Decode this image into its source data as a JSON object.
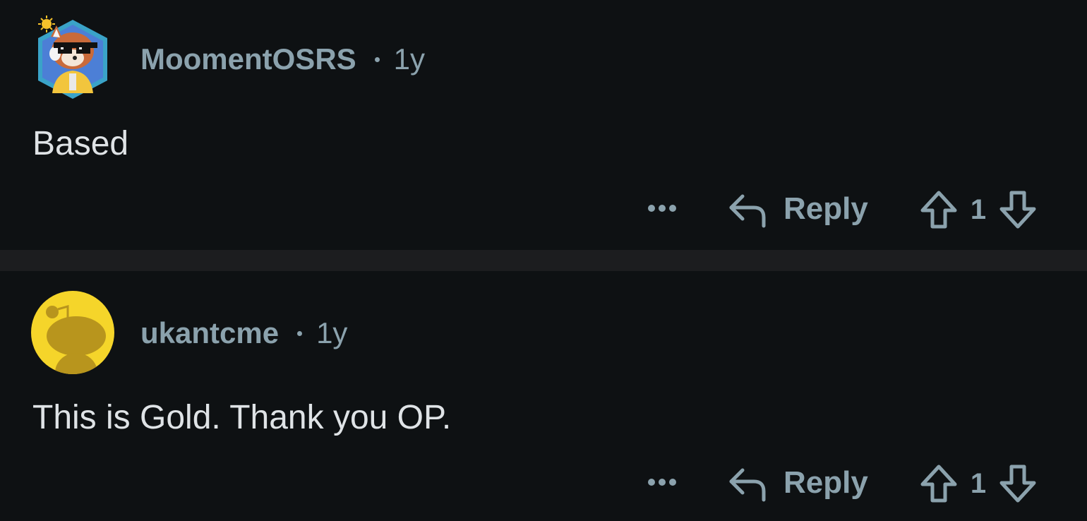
{
  "colors": {
    "background": "#0e1113",
    "divider": "#1c1d1f",
    "meta_text": "#8ba2ad",
    "body_text": "#dfe3e6",
    "snoo_avatar_bg": "#f5d52a"
  },
  "comments": [
    {
      "username": "MoomentOSRS",
      "time": "1y",
      "body": "Based",
      "avatar_icon": "red-panda-sunglasses-avatar",
      "actions": {
        "more_icon": "ellipsis-icon",
        "reply_icon": "reply-arrow-icon",
        "reply_label": "Reply",
        "upvote_icon": "upvote-arrow-icon",
        "score": "1",
        "downvote_icon": "downvote-arrow-icon"
      }
    },
    {
      "username": "ukantcme",
      "time": "1y",
      "body": "This is Gold. Thank you OP.",
      "avatar_icon": "snoo-avatar",
      "actions": {
        "more_icon": "ellipsis-icon",
        "reply_icon": "reply-arrow-icon",
        "reply_label": "Reply",
        "upvote_icon": "upvote-arrow-icon",
        "score": "1",
        "downvote_icon": "downvote-arrow-icon"
      }
    }
  ]
}
